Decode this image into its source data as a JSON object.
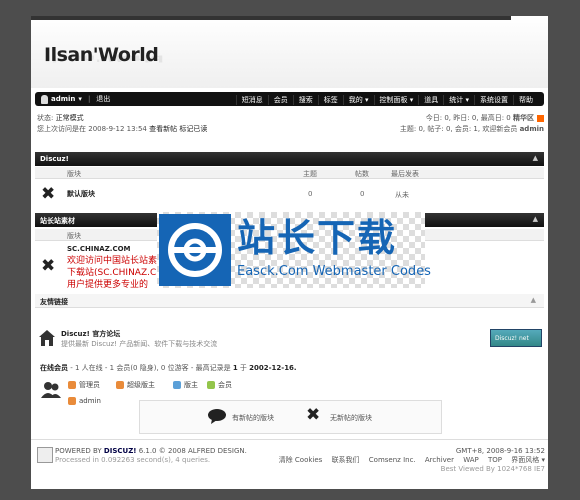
{
  "header": {
    "logo": "Ilsan'World"
  },
  "navbar": {
    "user": "admin",
    "user_caret": "▾",
    "logout": "退出",
    "items": [
      "短消息",
      "会员",
      "搜索",
      "标签",
      "我的 ▾",
      "控制面板 ▾",
      "道具",
      "统计 ▾",
      "系统设置",
      "帮助"
    ]
  },
  "status": {
    "line1_label": "状态:",
    "line1_value": "正常模式",
    "line2_label": "您上次访问是在",
    "line2_value": "2008-9-12 13:54",
    "line2_links": "查看新帖  标记已读"
  },
  "stats": {
    "line1": "今日: 0, 昨日: 0, 最高日: 0",
    "line1_link": "精华区",
    "line2": "主题: 0, 帖子: 0, 会员: 1, 欢迎新会员",
    "line2_user": "admin"
  },
  "sections": {
    "discuz": {
      "title": "Discuz!",
      "collapse": "▲",
      "columns": [
        "版块",
        "主题",
        "帖数",
        "最后发表"
      ],
      "forum_name": "默认版块",
      "threads": "0",
      "posts": "0",
      "last_post": "从未"
    },
    "site": {
      "title": "站长站素材",
      "collapse": "▲",
      "columns": [
        "版块"
      ],
      "forum_name": "SC.CHINAZ.COM",
      "desc_line1": "欢迎访问中国站长站素",
      "desc_line2": "下载站(SC.CHINAZ.C",
      "desc_line3": "用户提供更多专业的"
    },
    "links": {
      "title": "友情链接",
      "collapse": "▲",
      "name": "Discuz! 官方论坛",
      "desc": "提供最新 Discuz! 产品新闻、软件下载与技术交流",
      "badge": "Discuz! net"
    },
    "online": {
      "title": "在线会员",
      "summary": "- 1 人在线 - 1 会员(0 隐身), 0 位游客 - 最高记录是",
      "record_count": "1",
      "record_word": "于",
      "record_date": "2002-12-16.",
      "groups": [
        "管理员",
        "超级版主",
        "版主",
        "会员"
      ],
      "user": "admin",
      "group_colors": [
        "#e98b3a",
        "#e98b3a",
        "#5ba0d8",
        "#93c54b"
      ]
    },
    "legend": {
      "new_label": "有新帖的版块",
      "none_label": "无新帖的版块"
    }
  },
  "footer": {
    "powered_prefix": "POWERED BY",
    "powered_brand": "DISCUZ!",
    "powered_suffix": "6.1.0 © 2008 ALFRED DESIGN.",
    "processed": "Processed in 0.092263 second(s), 4 queries.",
    "time": "GMT+8, 2008-9-16 13:52",
    "links": [
      "清除 Cookies",
      "联系我们",
      "Comsenz Inc.",
      "Archiver",
      "WAP",
      "TOP",
      "界面风格 ▾"
    ],
    "best_view": "Best Viewed By 1024*768 IE7"
  },
  "overlay": {
    "cn": "站长下载",
    "en": "Easck.Com Webmaster Codes"
  }
}
